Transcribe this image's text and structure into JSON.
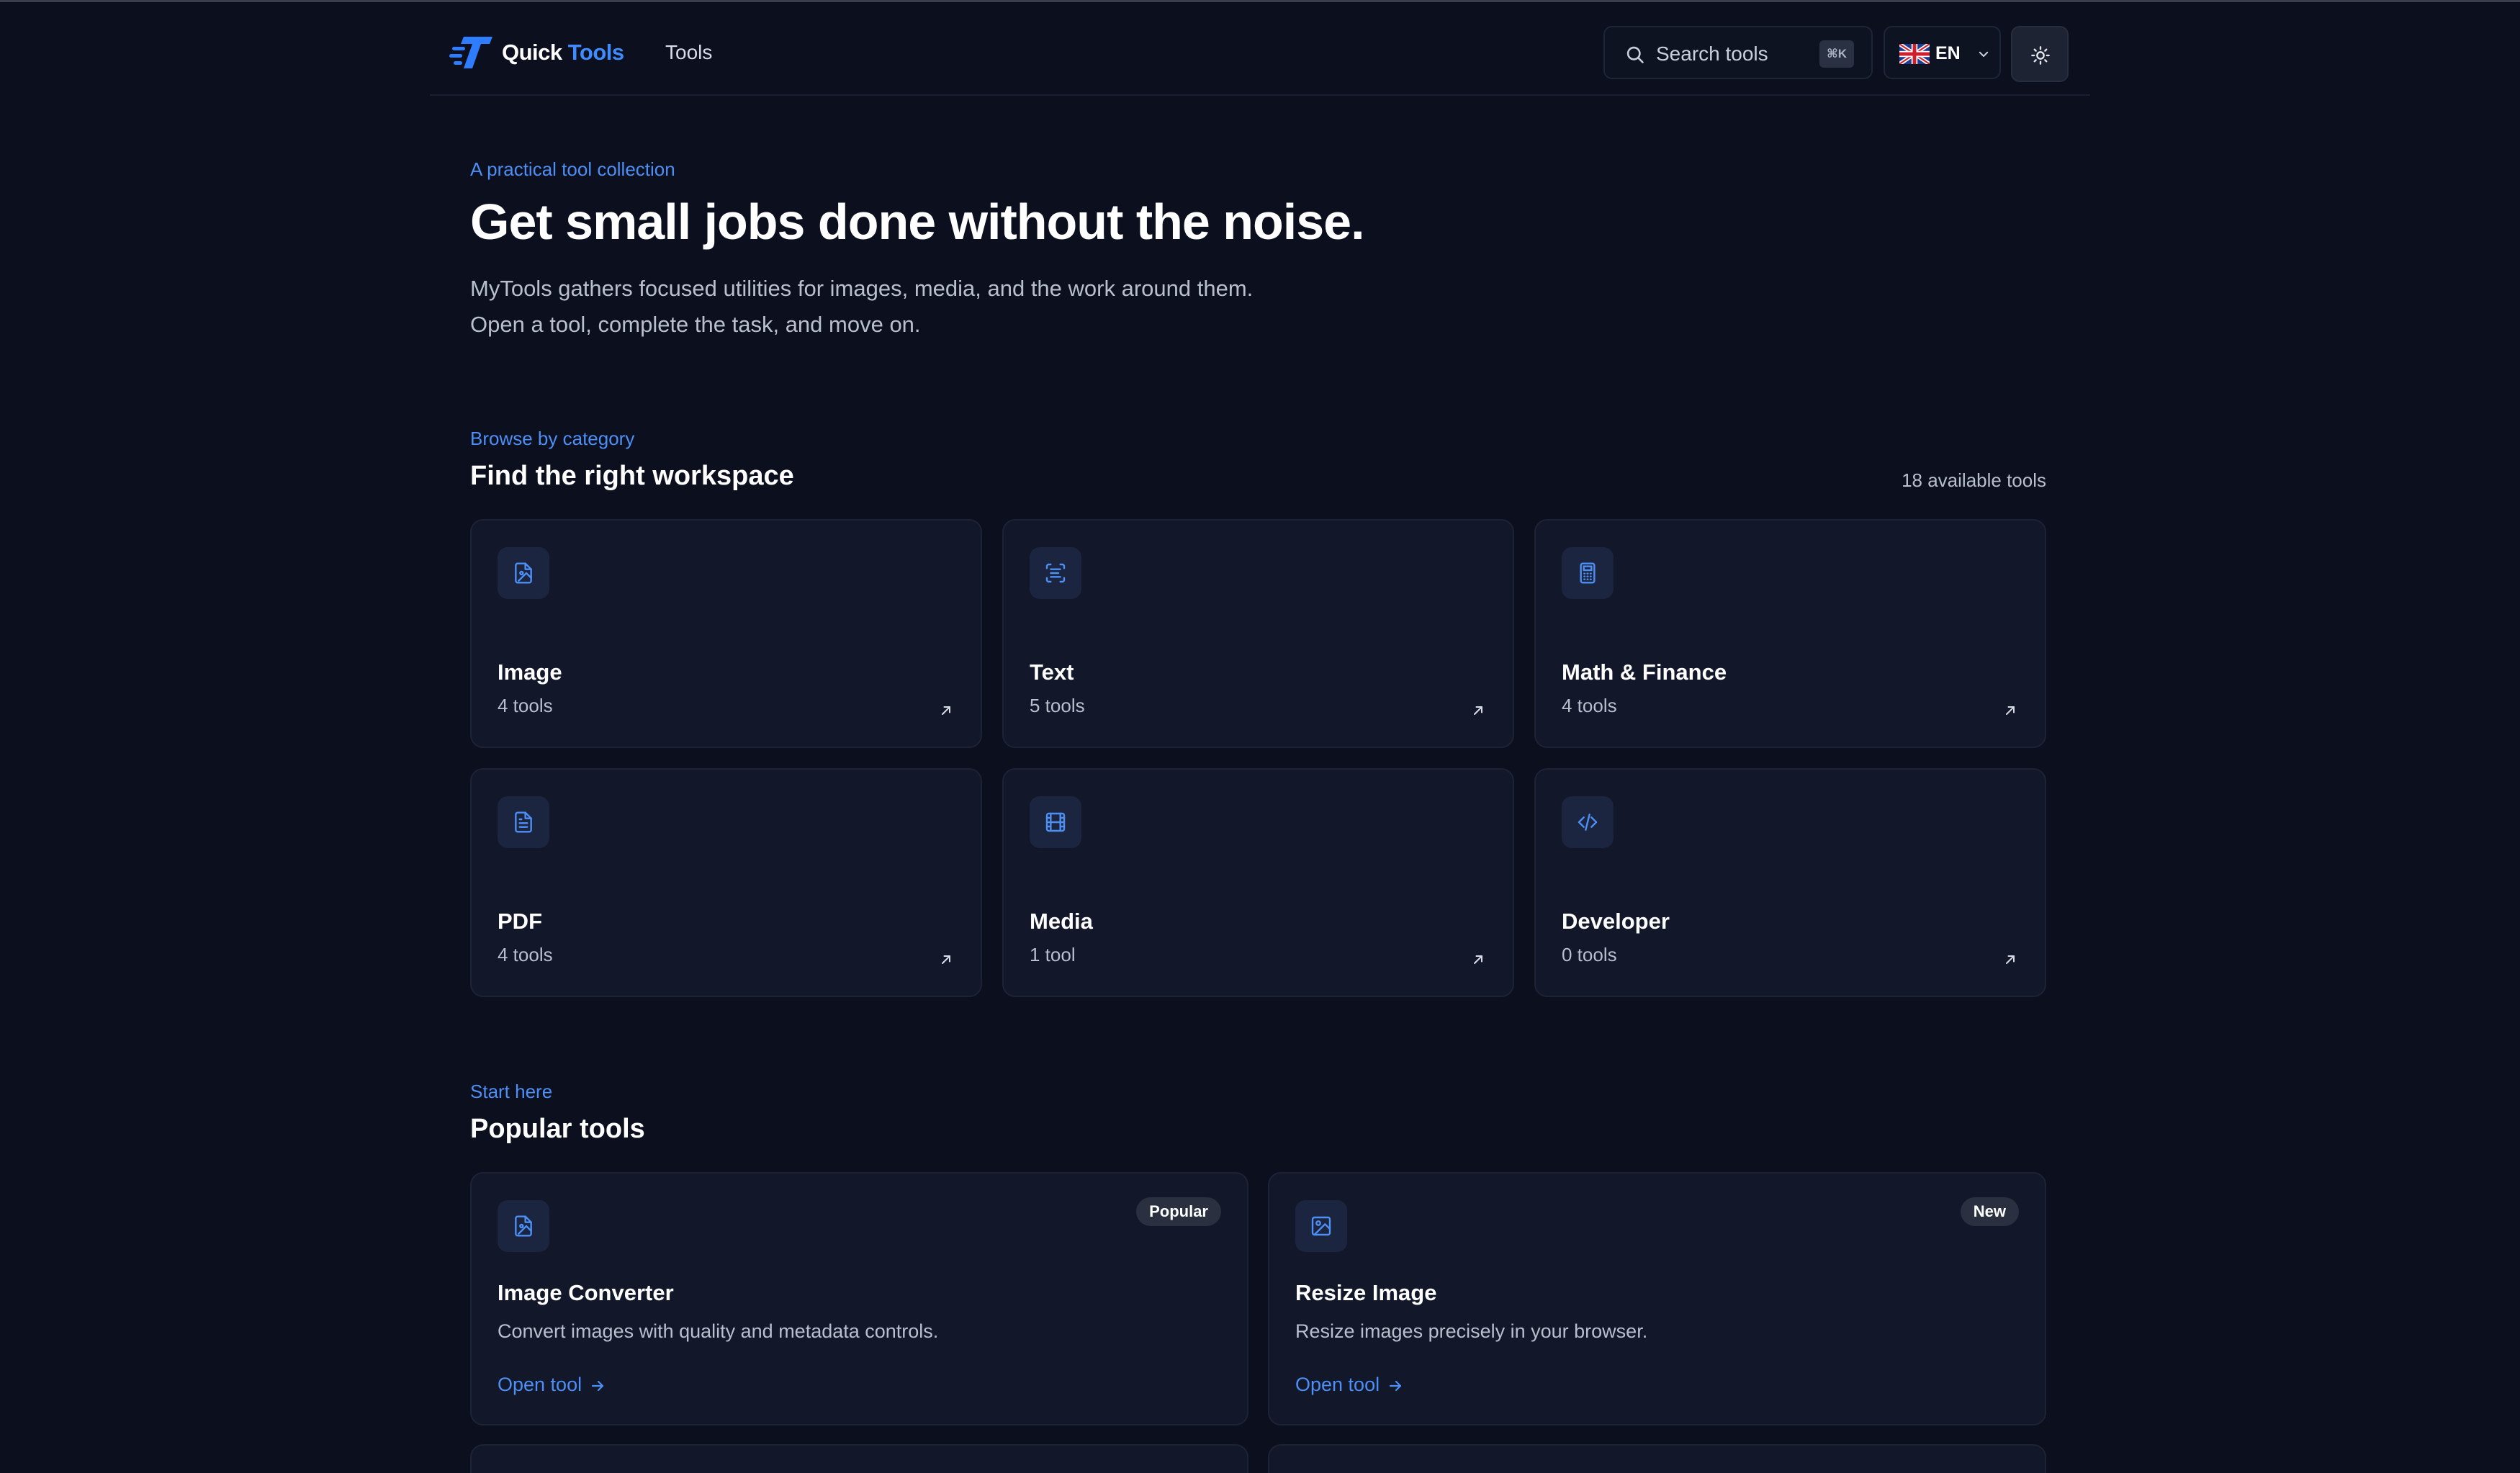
{
  "header": {
    "brand_part1": "Quick",
    "brand_part2": "Tools",
    "nav_tools": "Tools",
    "search_placeholder": "Search tools",
    "search_shortcut": "⌘K",
    "language_code": "EN",
    "icons": {
      "logo": "quicktools-logo",
      "search": "search-icon",
      "flag": "uk-flag-icon",
      "language_chevron": "chevron-down-icon",
      "theme": "sun-icon"
    }
  },
  "hero": {
    "eyebrow": "A practical tool collection",
    "title": "Get small jobs done without the noise.",
    "line1": "MyTools gathers focused utilities for images, media, and the work around them.",
    "line2": "Open a tool, complete the task, and move on."
  },
  "categories_section": {
    "eyebrow": "Browse by category",
    "title": "Find the right workspace",
    "count_note": "18 available tools",
    "items": [
      {
        "name": "Image",
        "count": "4 tools",
        "icon": "image-file-icon"
      },
      {
        "name": "Text",
        "count": "5 tools",
        "icon": "text-scan-icon"
      },
      {
        "name": "Math & Finance",
        "count": "4 tools",
        "icon": "calculator-icon"
      },
      {
        "name": "PDF",
        "count": "4 tools",
        "icon": "document-icon"
      },
      {
        "name": "Media",
        "count": "1 tool",
        "icon": "film-icon"
      },
      {
        "name": "Developer",
        "count": "0 tools",
        "icon": "code-icon"
      }
    ]
  },
  "popular_section": {
    "eyebrow": "Start here",
    "title": "Popular tools",
    "items": [
      {
        "name": "Image Converter",
        "description": "Convert images with quality and metadata controls.",
        "badge": "Popular",
        "link": "Open tool",
        "icon": "image-file-icon"
      },
      {
        "name": "Resize Image",
        "description": "Resize images precisely in your browser.",
        "badge": "New",
        "link": "Open tool",
        "icon": "picture-icon"
      }
    ]
  },
  "colors": {
    "background": "#0b0f1e",
    "card": "#121729",
    "accent": "#4d8ff5",
    "brand_blue": "#3f8cff",
    "muted_text": "#b8bfcd"
  }
}
